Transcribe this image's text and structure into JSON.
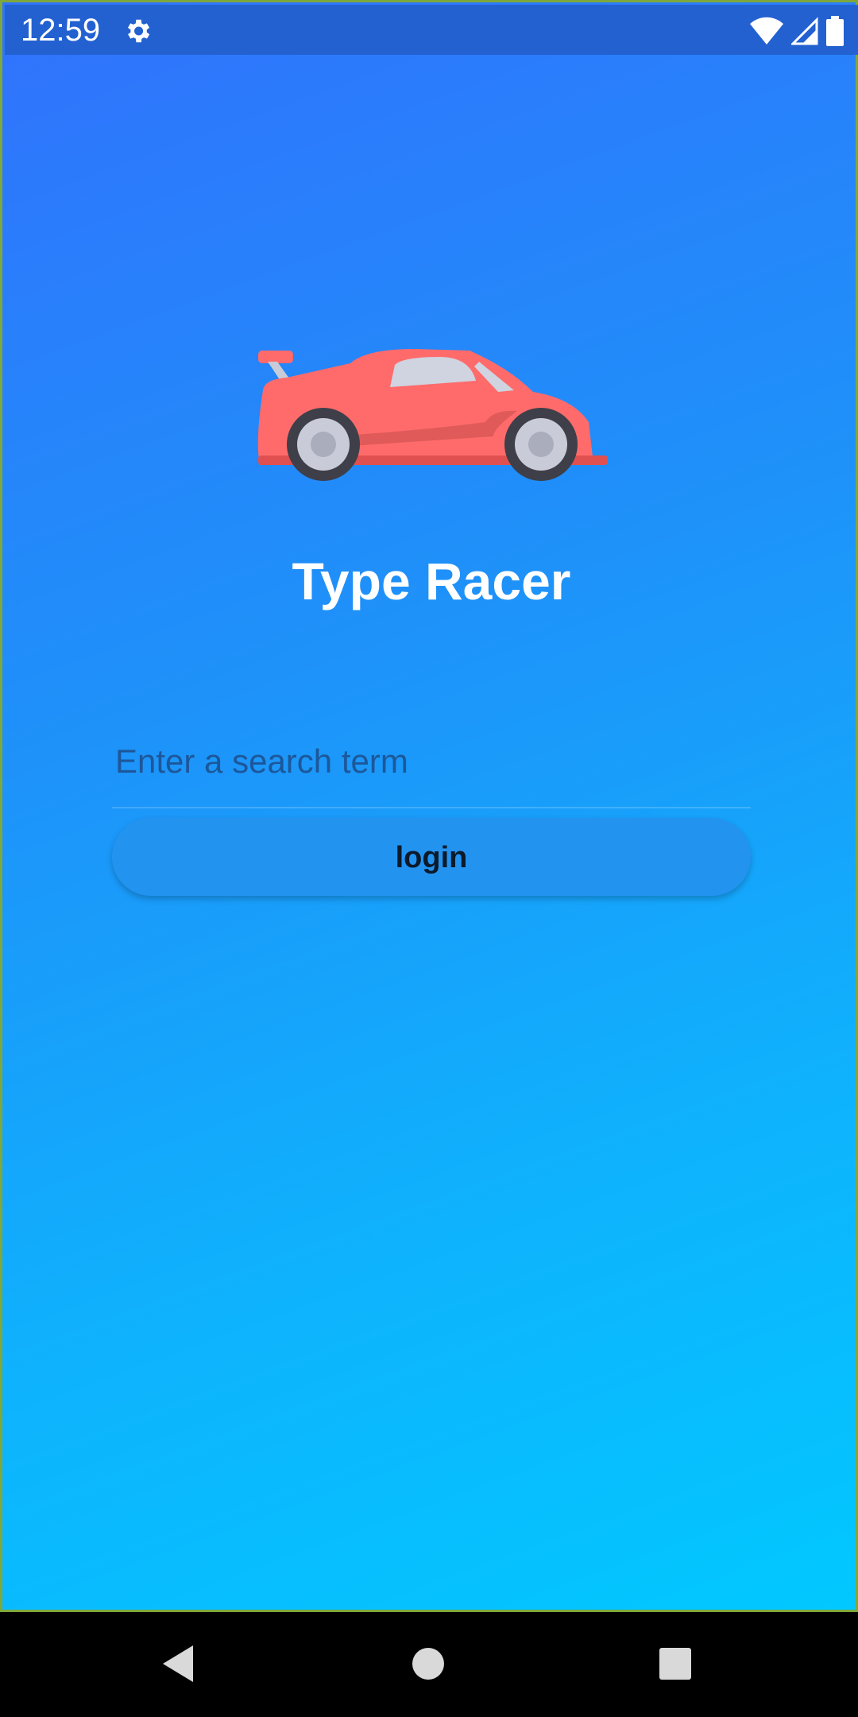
{
  "status_bar": {
    "time": "12:59",
    "icons": [
      "settings-icon",
      "wifi-icon",
      "signal-icon",
      "battery-icon"
    ]
  },
  "app": {
    "title": "Type Racer",
    "logo_icon": "race-car-icon",
    "search": {
      "value": "",
      "placeholder": "Enter a search term"
    },
    "login_label": "login"
  },
  "nav_bar": {
    "icons": [
      "back-icon",
      "home-icon",
      "recents-icon"
    ]
  },
  "colors": {
    "gradient_top": "#3172fd",
    "gradient_bottom": "#01c8ff",
    "status_bar": "#2361d1",
    "button": "#2393f0",
    "car_body": "#ff6b6b"
  }
}
